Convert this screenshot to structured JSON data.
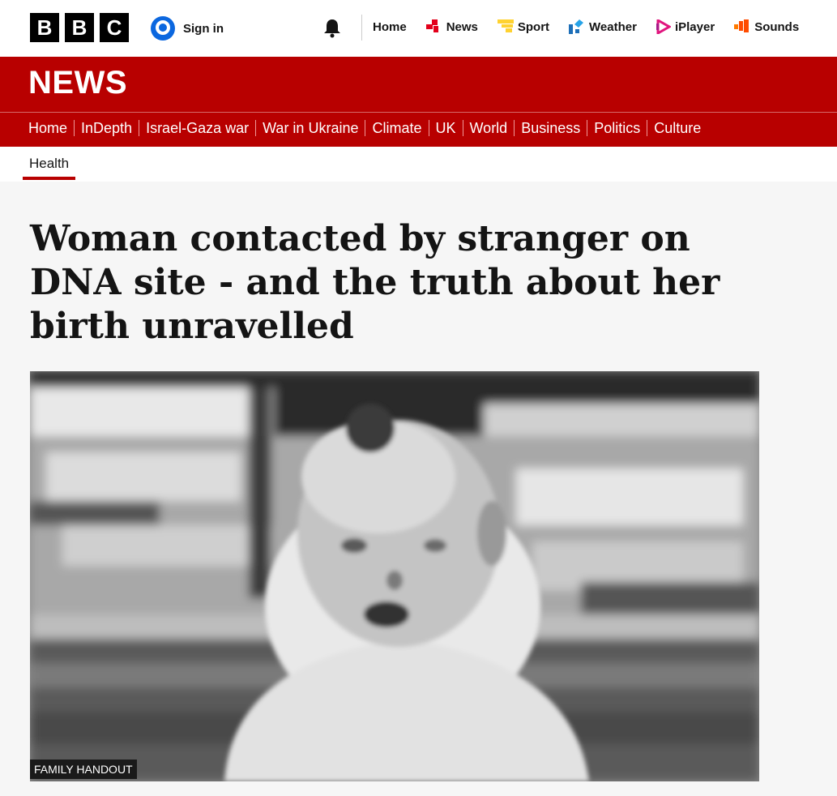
{
  "brand": {
    "letters": [
      "B",
      "B",
      "C"
    ]
  },
  "account": {
    "sign_in": "Sign in"
  },
  "top_nav": [
    {
      "label": "Home",
      "icon": "none"
    },
    {
      "label": "News",
      "icon": "news-icon",
      "color": "#e3001b"
    },
    {
      "label": "Sport",
      "icon": "sport-icon",
      "color": "#ffd230"
    },
    {
      "label": "Weather",
      "icon": "weather-icon",
      "color": "#1d6fb8"
    },
    {
      "label": "iPlayer",
      "icon": "iplayer-icon",
      "color": "#e0157e"
    },
    {
      "label": "Sounds",
      "icon": "sounds-icon",
      "color": "#ff4c00"
    }
  ],
  "masthead": {
    "title": "NEWS",
    "color": "#b80000"
  },
  "section_nav": [
    "Home",
    "InDepth",
    "Israel-Gaza war",
    "War in Ukraine",
    "Climate",
    "UK",
    "World",
    "Business",
    "Politics",
    "Culture"
  ],
  "subsection": {
    "active": "Health"
  },
  "article": {
    "headline": "Woman contacted by stranger on DNA site - and the truth about her birth unravelled",
    "image_caption": "FAMILY HANDOUT"
  }
}
